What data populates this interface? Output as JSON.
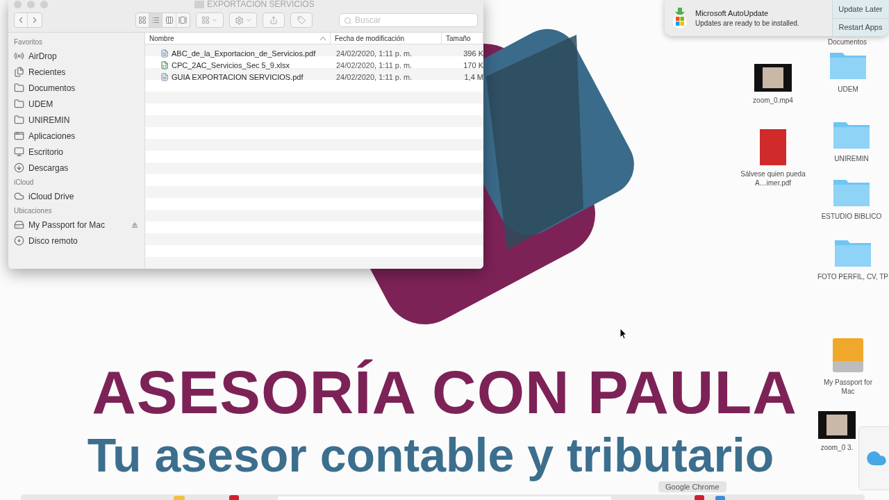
{
  "finder": {
    "title": "EXPORTACION SERVICIOS",
    "view_modes": [
      {
        "kind": "icons",
        "selected": false
      },
      {
        "kind": "list",
        "selected": true
      },
      {
        "kind": "columns",
        "selected": false
      },
      {
        "kind": "gallery",
        "selected": false
      }
    ],
    "search": {
      "placeholder": "Buscar"
    },
    "sidebar": [
      {
        "heading": "Favoritos",
        "items": [
          {
            "label": "AirDrop",
            "kind": "airdrop"
          },
          {
            "label": "Recientes",
            "kind": "recent"
          },
          {
            "label": "Documentos",
            "kind": "folder"
          },
          {
            "label": "UDEM",
            "kind": "folder"
          },
          {
            "label": "UNIREMIN",
            "kind": "folder"
          },
          {
            "label": "Aplicaciones",
            "kind": "apps"
          },
          {
            "label": "Escritorio",
            "kind": "desktop"
          },
          {
            "label": "Descargas",
            "kind": "download"
          }
        ]
      },
      {
        "heading": "iCloud",
        "items": [
          {
            "label": "iCloud Drive",
            "kind": "cloud"
          }
        ]
      },
      {
        "heading": "Ubicaciones",
        "items": [
          {
            "label": "My Passport for Mac",
            "kind": "drive",
            "ejectable": true
          },
          {
            "label": "Disco remoto",
            "kind": "disc",
            "ejectable": false
          }
        ]
      }
    ],
    "columns": [
      "Nombre",
      "Fecha de modificación",
      "Tamaño"
    ],
    "rows": [
      {
        "name": "ABC_de_la_Exportacion_de_Servicios.pdf",
        "kind": "pdf",
        "date": "24/02/2020, 1:11 p. m.",
        "size": "396 K"
      },
      {
        "name": "CPC_2AC_Servicios_Sec 5_9.xlsx",
        "kind": "xlsx",
        "date": "24/02/2020, 1:11 p. m.",
        "size": "170 K"
      },
      {
        "name": "GUIA EXPORTACION SERVICIOS.pdf",
        "kind": "pdf",
        "date": "24/02/2020, 1:11 p. m.",
        "size": "1,4 M"
      }
    ]
  },
  "notification": {
    "app": "Microsoft AutoUpdate",
    "message": "Updates are ready to be installed.",
    "buttons": [
      "Update Later",
      "Restart Apps"
    ]
  },
  "desktop_icons": [
    {
      "label": "Documentos",
      "kind": "none"
    },
    {
      "label": "zoom_0.mp4",
      "kind": "video"
    },
    {
      "label": "UDEM",
      "kind": "folder"
    },
    {
      "label": "Sálvese quien pueda A…imer.pdf",
      "kind": "book"
    },
    {
      "label": "UNIREMIN",
      "kind": "folder"
    },
    {
      "label": "ESTUDIO BIBLICO",
      "kind": "folder"
    },
    {
      "label": "FOTO PERFIL, CV, TP",
      "kind": "folder"
    },
    {
      "label": "My Passport for Mac",
      "kind": "drive"
    },
    {
      "label": "zoom_0 3.",
      "kind": "video"
    }
  ],
  "wallpaper": {
    "headline": "ASESORÍA CON PAULA",
    "tagline": "Tu asesor contable y tributario"
  },
  "dock_tooltip": "Google Chrome"
}
